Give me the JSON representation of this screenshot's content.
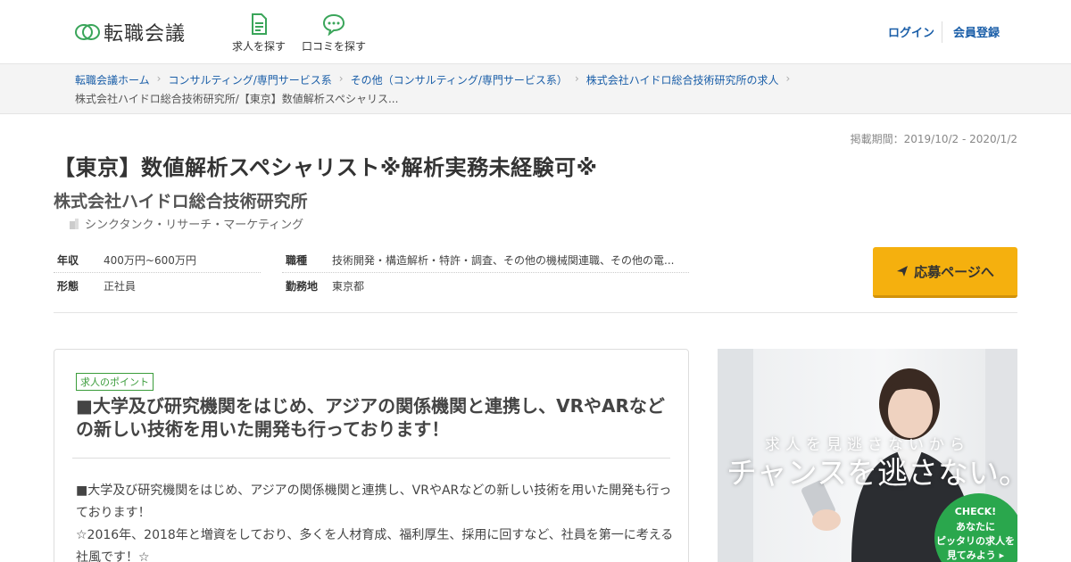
{
  "header": {
    "logo_text": "転職会議",
    "nav": [
      {
        "label": "求人を探す",
        "icon": "document-icon"
      },
      {
        "label": "口コミを探す",
        "icon": "chat-bubble-icon"
      }
    ],
    "login_label": "ログイン",
    "register_label": "会員登録"
  },
  "breadcrumb": {
    "items": [
      "転職会議ホーム",
      "コンサルティング/専門サービス系",
      "その他（コンサルティング/専門サービス系）",
      "株式会社ハイドロ総合技術研究所の求人"
    ],
    "current": "株式会社ハイドロ総合技術研究所/【東京】数値解析スペシャリス..."
  },
  "job": {
    "period": "掲載期間：2019/10/2 - 2020/1/2",
    "title": "【東京】数値解析スペシャリスト※解析実務未経験可※",
    "company": "株式会社ハイドロ総合技術研究所",
    "industry": "シンクタンク・リサーチ・マーケティング",
    "details": {
      "salary_key": "年収",
      "salary_val": "400万円~600万円",
      "type_key": "形態",
      "type_val": "正社員",
      "category_key": "職種",
      "category_val": "技術開発・構造解析・特許・調査、その他の機械関連職、その他の電...",
      "location_key": "勤務地",
      "location_val": "東京都"
    },
    "apply_label": "応募ページへ"
  },
  "point": {
    "badge": "求人のポイント",
    "heading": "■大学及び研究機関をはじめ、アジアの関係機関と連携し、VRやARなどの新しい技術を用いた開発も行っております！",
    "body_1": "■大学及び研究機関をはじめ、アジアの関係機関と連携し、VRやARなどの新しい技術を用いた開発も行っております！",
    "body_2": "☆2016年、2018年と増資をしており、多くを人材育成、福利厚生、採用に回すなど、社員を第一に考える社風です！☆"
  },
  "banner": {
    "tagline": "求人を見逃さないから",
    "main": "チャンスを逃さない。",
    "check_1": "CHECK!",
    "check_2": "あなたに",
    "check_3": "ピッタリの求人を",
    "check_4": "見てみよう ▸"
  },
  "colors": {
    "link": "#1a5ea8",
    "accent_yellow": "#f5b00e",
    "badge_green": "#3a9c3a",
    "check_green": "#2aa74d"
  }
}
